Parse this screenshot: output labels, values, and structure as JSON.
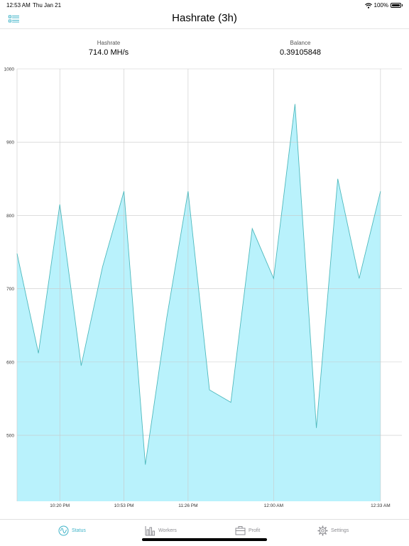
{
  "status_bar": {
    "time": "12:53 AM",
    "date": "Thu Jan 21",
    "battery": "100%"
  },
  "nav": {
    "title": "Hashrate (3h)"
  },
  "stats": {
    "hashrate_label": "Hashrate",
    "hashrate_value": "714.0 MH/s",
    "balance_label": "Balance",
    "balance_value": "0.39105848"
  },
  "tabs": [
    {
      "label": "Status",
      "icon": "status-icon",
      "active": true
    },
    {
      "label": "Workers",
      "icon": "workers-icon",
      "active": false
    },
    {
      "label": "Profit",
      "icon": "profit-icon",
      "active": false
    },
    {
      "label": "Settings",
      "icon": "gear-icon",
      "active": false
    }
  ],
  "colors": {
    "accent": "#3fb3c8",
    "fill": "#b9f2fc",
    "line": "#4fb9bd"
  },
  "chart_data": {
    "type": "area",
    "x": [
      "10:05 PM",
      "10:11 PM",
      "10:20 PM",
      "10:26 PM",
      "10:33 PM",
      "10:53 PM",
      "10:59 PM",
      "11:06 PM",
      "11:26 PM",
      "11:32 PM",
      "11:39 PM",
      "11:46 PM",
      "12:00 AM",
      "12:06 AM",
      "12:13 AM",
      "12:19 AM",
      "12:26 AM",
      "12:33 AM",
      "12:39 AM"
    ],
    "series": [
      {
        "values": [
          748,
          612,
          815,
          595,
          730,
          833,
          460,
          660,
          833,
          562,
          545,
          782,
          714,
          952,
          510,
          850,
          714,
          833
        ]
      }
    ],
    "x_ticks": [
      "10:20 PM",
      "10:53 PM",
      "11:26 PM",
      "12:00 AM",
      "12:33 AM"
    ],
    "y_ticks": [
      500,
      600,
      700,
      800,
      900,
      1000
    ],
    "ylim": [
      410,
      1000
    ],
    "grid": true
  }
}
